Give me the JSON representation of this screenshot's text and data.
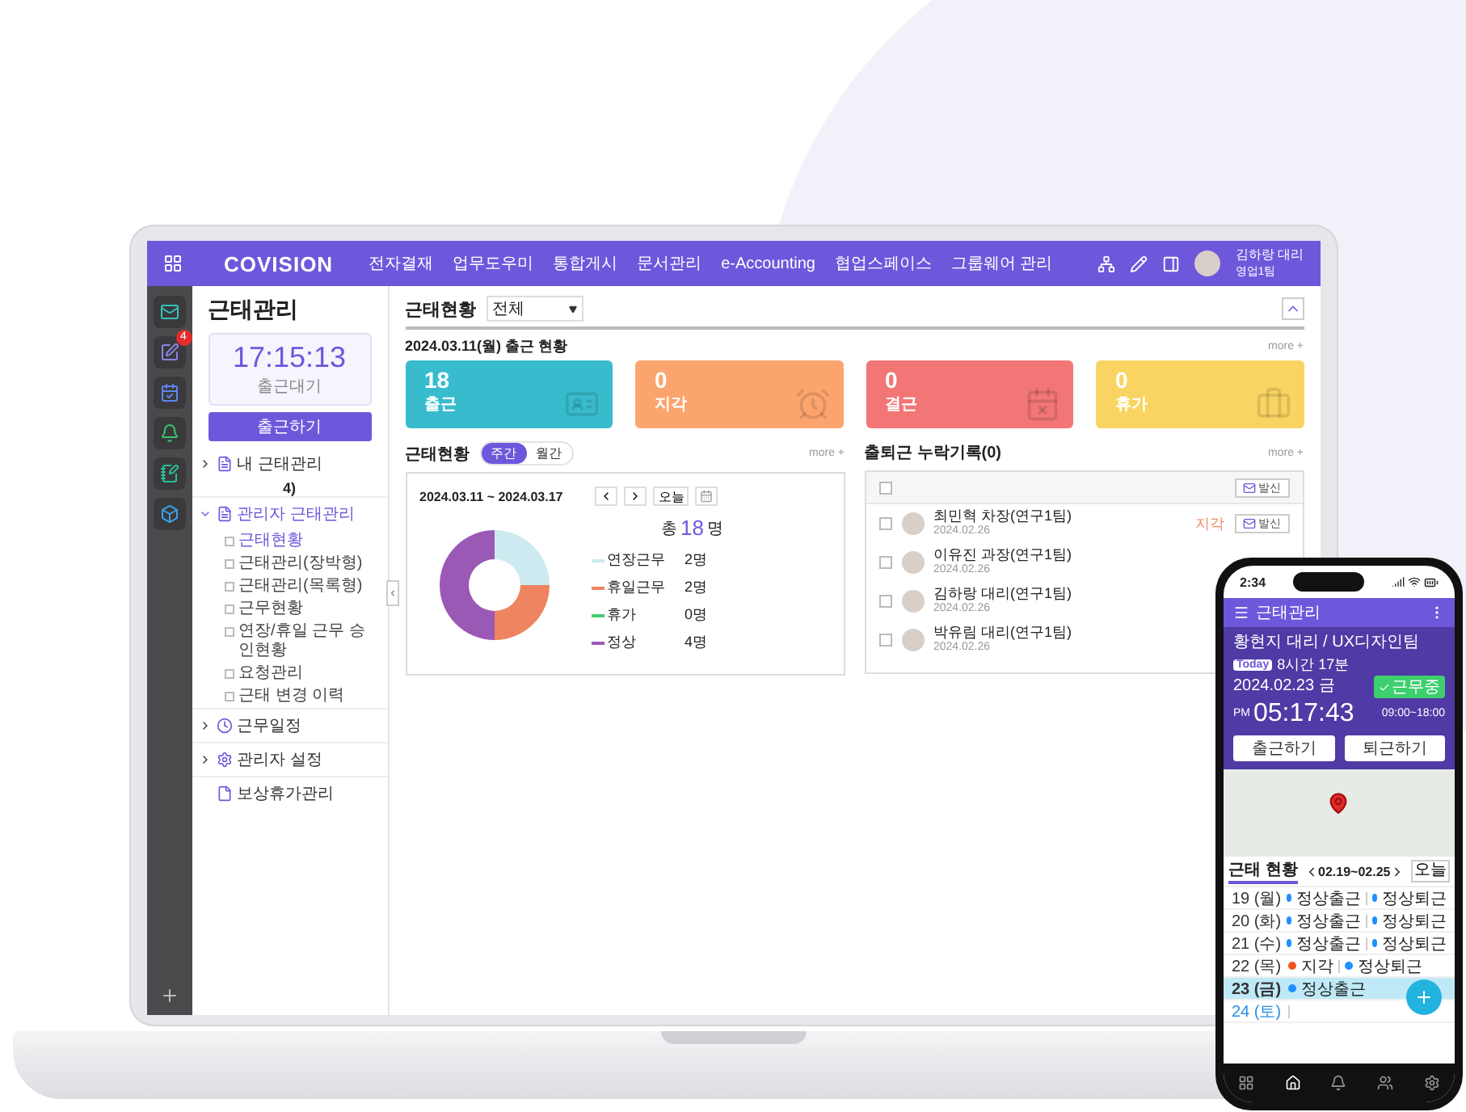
{
  "header": {
    "logo": "COVISION",
    "menu": [
      "전자결재",
      "업무도우미",
      "통합게시",
      "문서관리",
      "e-Accounting",
      "협업스페이스",
      "그룹웨어 관리"
    ],
    "user": {
      "name": "김하랑 대리",
      "team": "영업1팀"
    }
  },
  "icon_rail": {
    "badge": "4"
  },
  "sidebar": {
    "title": "근태관리",
    "clock": {
      "time": "17:15:13",
      "status": "출근대기"
    },
    "clock_in_button": "출근하기",
    "note": "4)",
    "tree": [
      {
        "label": "내 근태관리",
        "kind": "doc",
        "expanded": false,
        "selected": false
      },
      {
        "label": "관리자 근태관리",
        "kind": "doc",
        "expanded": true,
        "selected": true,
        "children": [
          {
            "label": "근태현황",
            "selected": true
          },
          {
            "label": "근태관리(장박형)",
            "selected": false
          },
          {
            "label": "근태관리(목록형)",
            "selected": false
          },
          {
            "label": "근무현황",
            "selected": false
          },
          {
            "label": "연장/휴일 근무 승인현황",
            "selected": false
          },
          {
            "label": "요청관리",
            "selected": false
          },
          {
            "label": "근태 변경 이력",
            "selected": false
          }
        ]
      },
      {
        "label": "근무일정",
        "kind": "clock",
        "expanded": false,
        "selected": false
      },
      {
        "label": "관리자 설정",
        "kind": "gear",
        "expanded": false,
        "selected": false
      },
      {
        "label": "보상휴가관리",
        "kind": "page",
        "expanded": false,
        "selected": false
      }
    ]
  },
  "main": {
    "title": "근태현황",
    "filter": {
      "value": "전체"
    },
    "today": {
      "heading": "2024.03.11(월) 출근 현황",
      "more": "more +",
      "cards": [
        {
          "count": "18",
          "label": "출근",
          "color": "#38bccd",
          "kind": "badge"
        },
        {
          "count": "0",
          "label": "지각",
          "color": "#fca46e",
          "kind": "clock"
        },
        {
          "count": "0",
          "label": "결근",
          "color": "#f37676",
          "kind": "calendar"
        },
        {
          "count": "0",
          "label": "휴가",
          "color": "#f9d462",
          "kind": "suitcase"
        }
      ]
    },
    "weekly": {
      "title": "근태현황",
      "tabs": [
        {
          "label": "주간",
          "selected": true
        },
        {
          "label": "월간",
          "selected": false
        }
      ],
      "more": "more +",
      "range": "2024.03.11 ~ 2024.03.17",
      "today_button": "오늘",
      "total": {
        "prefix": "총",
        "count": "18",
        "suffix": "명"
      },
      "legend": [
        {
          "value": "2명",
          "color": "#cdeaf0"
        },
        {
          "value": "2명",
          "color": "#ee8460"
        },
        {
          "value": "0명",
          "color": "#3ecf6e"
        },
        {
          "value": "4명",
          "color": "#9b59b6"
        }
      ],
      "chart_data": {
        "type": "donut",
        "categories": [
          "연장근무",
          "휴일근무",
          "휴가",
          "정상"
        ],
        "values": [
          25,
          25,
          0,
          50
        ]
      }
    },
    "missing": {
      "title": "출퇴근 누락기록(0)",
      "more": "more +",
      "send_button": "발신",
      "header_checked": false,
      "rows": [
        {
          "name": "최민혁 차장(연구1팀)",
          "date": "2024.02.26",
          "checked": false,
          "status": "지각",
          "button": "발신"
        },
        {
          "name": "이유진 과장(연구1팀)",
          "date": "2024.02.26",
          "checked": false
        },
        {
          "name": "김하랑 대리(연구1팀)",
          "date": "2024.02.26",
          "checked": false
        },
        {
          "name": "박유림 대리(연구1팀)",
          "date": "2024.02.26",
          "checked": false
        }
      ]
    }
  },
  "phone": {
    "time": "2:34",
    "title": "근태관리",
    "user": "황현지 대리 / UX디자인팀",
    "today_badge": "Today",
    "worked": "8시간 17분",
    "date": "2024.02.23 금",
    "state_badge": "근무중",
    "ampm": "PM",
    "clock": "05:17:43",
    "hours": "09:00~18:00",
    "buttons": [
      "출근하기",
      "퇴근하기"
    ],
    "tab": "근태 현황",
    "range": "02.19~02.25",
    "today_button": "오늘",
    "days": [
      {
        "day": "19 (월)",
        "selected": false,
        "weekend": false,
        "entries": [
          {
            "label": "정상출근",
            "color": "#1f8fff"
          },
          {
            "label": "정상퇴근",
            "color": "#1f8fff"
          }
        ]
      },
      {
        "day": "20 (화)",
        "selected": false,
        "weekend": false,
        "entries": [
          {
            "label": "정상출근",
            "color": "#1f8fff"
          },
          {
            "label": "정상퇴근",
            "color": "#1f8fff"
          }
        ]
      },
      {
        "day": "21 (수)",
        "selected": false,
        "weekend": false,
        "entries": [
          {
            "label": "정상출근",
            "color": "#1f8fff"
          },
          {
            "label": "정상퇴근",
            "color": "#1f8fff"
          }
        ]
      },
      {
        "day": "22 (목)",
        "selected": false,
        "weekend": false,
        "entries": [
          {
            "label": "지각",
            "color": "#f2541b"
          },
          {
            "label": "정상퇴근",
            "color": "#1f8fff"
          }
        ]
      },
      {
        "day": "23 (금)",
        "selected": true,
        "weekend": false,
        "entries": [
          {
            "label": "정상출근",
            "color": "#1f8fff"
          }
        ]
      },
      {
        "day": "24 (토)",
        "selected": false,
        "weekend": true
      }
    ],
    "nav": [
      {
        "kind": "grid",
        "selected": false
      },
      {
        "kind": "home",
        "selected": true
      },
      {
        "kind": "bell",
        "selected": false
      },
      {
        "kind": "people",
        "selected": false
      },
      {
        "kind": "gear",
        "selected": false
      }
    ]
  }
}
